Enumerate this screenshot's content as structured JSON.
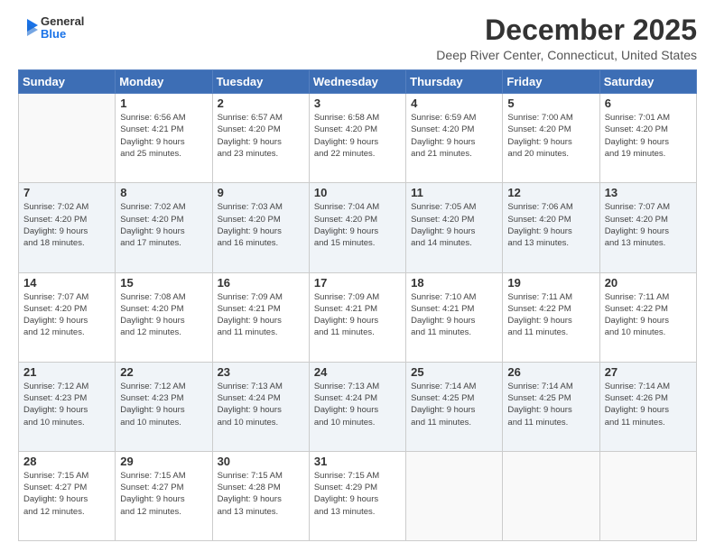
{
  "logo": {
    "line1": "General",
    "line2": "Blue"
  },
  "header": {
    "month": "December 2025",
    "location": "Deep River Center, Connecticut, United States"
  },
  "weekdays": [
    "Sunday",
    "Monday",
    "Tuesday",
    "Wednesday",
    "Thursday",
    "Friday",
    "Saturday"
  ],
  "weeks": [
    [
      {
        "day": "",
        "info": ""
      },
      {
        "day": "1",
        "info": "Sunrise: 6:56 AM\nSunset: 4:21 PM\nDaylight: 9 hours\nand 25 minutes."
      },
      {
        "day": "2",
        "info": "Sunrise: 6:57 AM\nSunset: 4:20 PM\nDaylight: 9 hours\nand 23 minutes."
      },
      {
        "day": "3",
        "info": "Sunrise: 6:58 AM\nSunset: 4:20 PM\nDaylight: 9 hours\nand 22 minutes."
      },
      {
        "day": "4",
        "info": "Sunrise: 6:59 AM\nSunset: 4:20 PM\nDaylight: 9 hours\nand 21 minutes."
      },
      {
        "day": "5",
        "info": "Sunrise: 7:00 AM\nSunset: 4:20 PM\nDaylight: 9 hours\nand 20 minutes."
      },
      {
        "day": "6",
        "info": "Sunrise: 7:01 AM\nSunset: 4:20 PM\nDaylight: 9 hours\nand 19 minutes."
      }
    ],
    [
      {
        "day": "7",
        "info": "Sunrise: 7:02 AM\nSunset: 4:20 PM\nDaylight: 9 hours\nand 18 minutes."
      },
      {
        "day": "8",
        "info": "Sunrise: 7:02 AM\nSunset: 4:20 PM\nDaylight: 9 hours\nand 17 minutes."
      },
      {
        "day": "9",
        "info": "Sunrise: 7:03 AM\nSunset: 4:20 PM\nDaylight: 9 hours\nand 16 minutes."
      },
      {
        "day": "10",
        "info": "Sunrise: 7:04 AM\nSunset: 4:20 PM\nDaylight: 9 hours\nand 15 minutes."
      },
      {
        "day": "11",
        "info": "Sunrise: 7:05 AM\nSunset: 4:20 PM\nDaylight: 9 hours\nand 14 minutes."
      },
      {
        "day": "12",
        "info": "Sunrise: 7:06 AM\nSunset: 4:20 PM\nDaylight: 9 hours\nand 13 minutes."
      },
      {
        "day": "13",
        "info": "Sunrise: 7:07 AM\nSunset: 4:20 PM\nDaylight: 9 hours\nand 13 minutes."
      }
    ],
    [
      {
        "day": "14",
        "info": "Sunrise: 7:07 AM\nSunset: 4:20 PM\nDaylight: 9 hours\nand 12 minutes."
      },
      {
        "day": "15",
        "info": "Sunrise: 7:08 AM\nSunset: 4:20 PM\nDaylight: 9 hours\nand 12 minutes."
      },
      {
        "day": "16",
        "info": "Sunrise: 7:09 AM\nSunset: 4:21 PM\nDaylight: 9 hours\nand 11 minutes."
      },
      {
        "day": "17",
        "info": "Sunrise: 7:09 AM\nSunset: 4:21 PM\nDaylight: 9 hours\nand 11 minutes."
      },
      {
        "day": "18",
        "info": "Sunrise: 7:10 AM\nSunset: 4:21 PM\nDaylight: 9 hours\nand 11 minutes."
      },
      {
        "day": "19",
        "info": "Sunrise: 7:11 AM\nSunset: 4:22 PM\nDaylight: 9 hours\nand 11 minutes."
      },
      {
        "day": "20",
        "info": "Sunrise: 7:11 AM\nSunset: 4:22 PM\nDaylight: 9 hours\nand 10 minutes."
      }
    ],
    [
      {
        "day": "21",
        "info": "Sunrise: 7:12 AM\nSunset: 4:23 PM\nDaylight: 9 hours\nand 10 minutes."
      },
      {
        "day": "22",
        "info": "Sunrise: 7:12 AM\nSunset: 4:23 PM\nDaylight: 9 hours\nand 10 minutes."
      },
      {
        "day": "23",
        "info": "Sunrise: 7:13 AM\nSunset: 4:24 PM\nDaylight: 9 hours\nand 10 minutes."
      },
      {
        "day": "24",
        "info": "Sunrise: 7:13 AM\nSunset: 4:24 PM\nDaylight: 9 hours\nand 10 minutes."
      },
      {
        "day": "25",
        "info": "Sunrise: 7:14 AM\nSunset: 4:25 PM\nDaylight: 9 hours\nand 11 minutes."
      },
      {
        "day": "26",
        "info": "Sunrise: 7:14 AM\nSunset: 4:25 PM\nDaylight: 9 hours\nand 11 minutes."
      },
      {
        "day": "27",
        "info": "Sunrise: 7:14 AM\nSunset: 4:26 PM\nDaylight: 9 hours\nand 11 minutes."
      }
    ],
    [
      {
        "day": "28",
        "info": "Sunrise: 7:15 AM\nSunset: 4:27 PM\nDaylight: 9 hours\nand 12 minutes."
      },
      {
        "day": "29",
        "info": "Sunrise: 7:15 AM\nSunset: 4:27 PM\nDaylight: 9 hours\nand 12 minutes."
      },
      {
        "day": "30",
        "info": "Sunrise: 7:15 AM\nSunset: 4:28 PM\nDaylight: 9 hours\nand 13 minutes."
      },
      {
        "day": "31",
        "info": "Sunrise: 7:15 AM\nSunset: 4:29 PM\nDaylight: 9 hours\nand 13 minutes."
      },
      {
        "day": "",
        "info": ""
      },
      {
        "day": "",
        "info": ""
      },
      {
        "day": "",
        "info": ""
      }
    ]
  ]
}
